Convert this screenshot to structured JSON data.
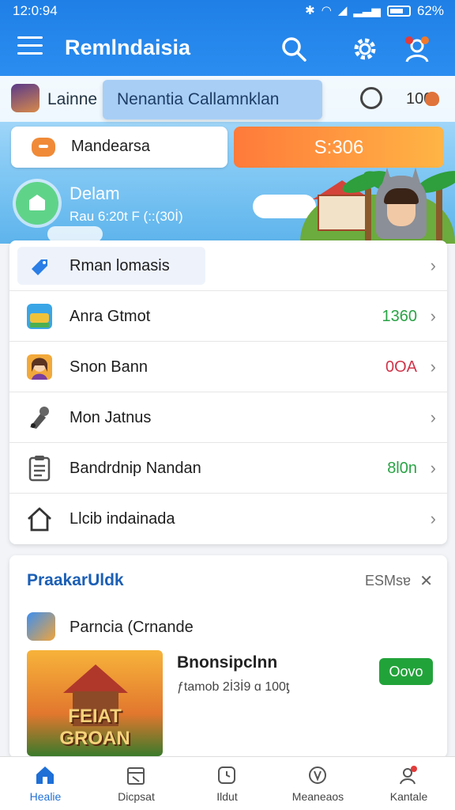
{
  "status_bar": {
    "time": "12:0:94",
    "battery": "62%"
  },
  "app_bar": {
    "title": "Remlndaisia"
  },
  "banner": {
    "user_name": "Lainne",
    "mode_chip": "Nenantia Callamnklan",
    "count": "100",
    "mode_label": "Mandearsa",
    "balance": "S:306",
    "rec_title": "Delam",
    "rec_sub": "Rau 6:20t F (::(30İ)"
  },
  "menu": {
    "items": [
      {
        "label": "Rman lomasis",
        "value": "",
        "icon": "tag-icon"
      },
      {
        "label": "Anra Gtmot",
        "value": "1360",
        "value_color": "#2aa346",
        "icon": "game-icon"
      },
      {
        "label": "Snon Bann",
        "value": "0OA",
        "value_color": "#d0344a",
        "icon": "avatar-icon"
      },
      {
        "label": "Mon Jatnus",
        "value": "",
        "icon": "tools-icon"
      },
      {
        "label": "Bandrdnip Nandan",
        "value": "8l0n",
        "value_color": "#2aa346",
        "icon": "clipboard-icon"
      },
      {
        "label": "Llcib indainada",
        "value": "",
        "icon": "home-icon"
      }
    ]
  },
  "news": {
    "title": "PraakarUldk",
    "tag": "ESMsɐ",
    "promo_label": "Parncia (Crnande",
    "game_title": "Bnonsipclnn",
    "game_meta": "ƒtamob 2İ3İ9 ɑ 100ƫ",
    "thumb_text": "FEIAT GROAN",
    "open_label": "Oovo"
  },
  "bottom_nav": {
    "items": [
      {
        "label": "Healie",
        "icon": "home-icon"
      },
      {
        "label": "Dicpsat",
        "icon": "calendar-icon"
      },
      {
        "label": "Ildut",
        "icon": "clock-icon"
      },
      {
        "label": "Meaneaos",
        "icon": "globe-icon"
      },
      {
        "label": "Kantale",
        "icon": "profile-icon"
      }
    ]
  }
}
